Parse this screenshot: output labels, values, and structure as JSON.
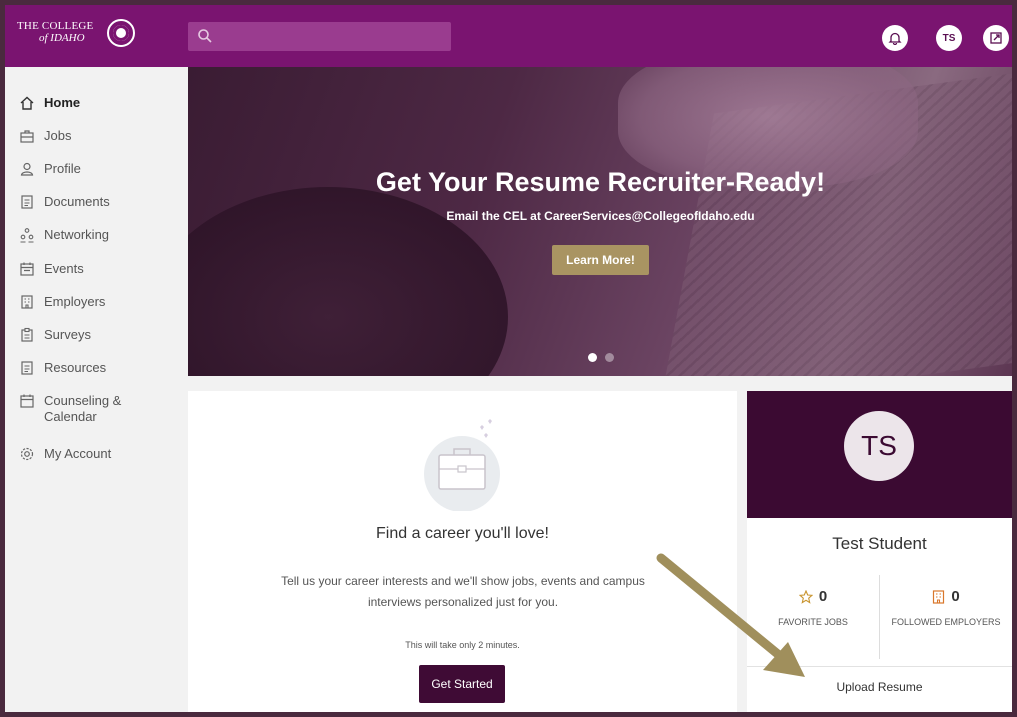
{
  "header": {
    "logo_line1": "THE COLLEGE",
    "logo_line2": "of IDAHO",
    "search_placeholder": "",
    "avatar_initials": "TS"
  },
  "sidebar": {
    "items": [
      {
        "label": "Home",
        "icon": "home-icon",
        "active": true
      },
      {
        "label": "Jobs",
        "icon": "briefcase-icon",
        "active": false
      },
      {
        "label": "Profile",
        "icon": "person-icon",
        "active": false
      },
      {
        "label": "Documents",
        "icon": "document-icon",
        "active": false
      },
      {
        "label": "Networking",
        "icon": "network-icon",
        "active": false
      },
      {
        "label": "Events",
        "icon": "calendar-icon",
        "active": false
      },
      {
        "label": "Employers",
        "icon": "building-icon",
        "active": false
      },
      {
        "label": "Surveys",
        "icon": "clipboard-icon",
        "active": false
      },
      {
        "label": "Resources",
        "icon": "document-icon",
        "active": false
      },
      {
        "label": "Counseling &",
        "label2": "Calendar",
        "icon": "calendar-icon",
        "active": false
      },
      {
        "label": "My Account",
        "icon": "gear-icon",
        "active": false
      }
    ]
  },
  "hero": {
    "title": "Get Your Resume Recruiter-Ready!",
    "subtitle": "Email the CEL at CareerServices@CollegeofIdaho.edu",
    "button": "Learn More!"
  },
  "career_card": {
    "title": "Find a career you'll love!",
    "description": "Tell us your career interests and we'll show jobs, events and campus interviews personalized just for you.",
    "note": "This will take only 2 minutes.",
    "button": "Get Started"
  },
  "profile_card": {
    "initials": "TS",
    "name": "Test Student",
    "favorite_jobs_count": "0",
    "favorite_jobs_label": "FAVORITE JOBS",
    "followed_employers_count": "0",
    "followed_employers_label": "FOLLOWED EMPLOYERS",
    "upload_label": "Upload Resume"
  },
  "colors": {
    "header_bg": "#7a1470",
    "profile_header_bg": "#3b0a32",
    "hero_button": "#a99462",
    "primary_button": "#3f0b35",
    "arrow": "#a08f5c"
  }
}
